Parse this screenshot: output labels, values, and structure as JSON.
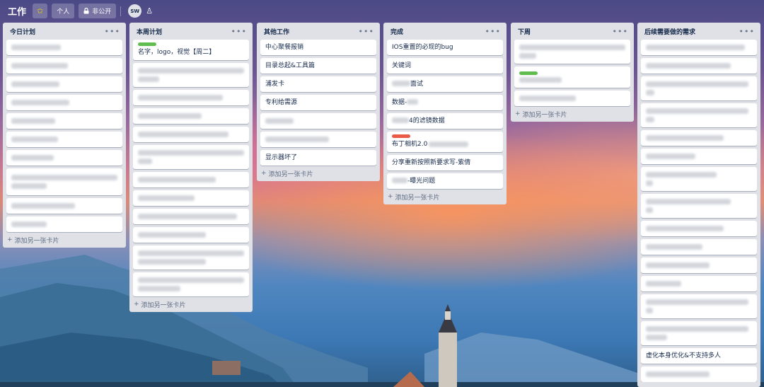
{
  "header": {
    "board_title": "工作",
    "team_label": "个人",
    "visibility_label": "非公开",
    "member_initials": "SW"
  },
  "lists": {
    "today": {
      "title": "今日计划",
      "add_card": "添加另一张卡片"
    },
    "week": {
      "title": "本周计划",
      "first_card": "名字，logo，视觉【周二】",
      "label_color": "#61bd4f",
      "add_card": "添加另一张卡片"
    },
    "other": {
      "title": "其他工作",
      "cards": [
        "中心聚餐报销",
        "目录总起&工具篇",
        "浦发卡",
        "专利给需源",
        "显示器坏了"
      ],
      "add_card": "添加另一张卡片"
    },
    "done": {
      "title": "完成",
      "cards": [
        "IOS重置的必现的bug",
        "关键词",
        "面试",
        "数据-",
        "4的滤镜数据",
        "布丁相机2.0",
        "分享重新按照新要求写-紫倩",
        "-曝光问题"
      ],
      "label_color": "#eb5a46",
      "add_card": "添加另一张卡片"
    },
    "next_week": {
      "title": "下周",
      "label_color": "#61bd4f",
      "add_card": "添加另一张卡片"
    },
    "backlog": {
      "title": "后续需要做的需求",
      "last_card": "虚化本身优化&不支持多人"
    }
  },
  "colors": {
    "list_bg": "#dfe1e6",
    "card_bg": "#ffffff",
    "text": "#172b4d"
  }
}
